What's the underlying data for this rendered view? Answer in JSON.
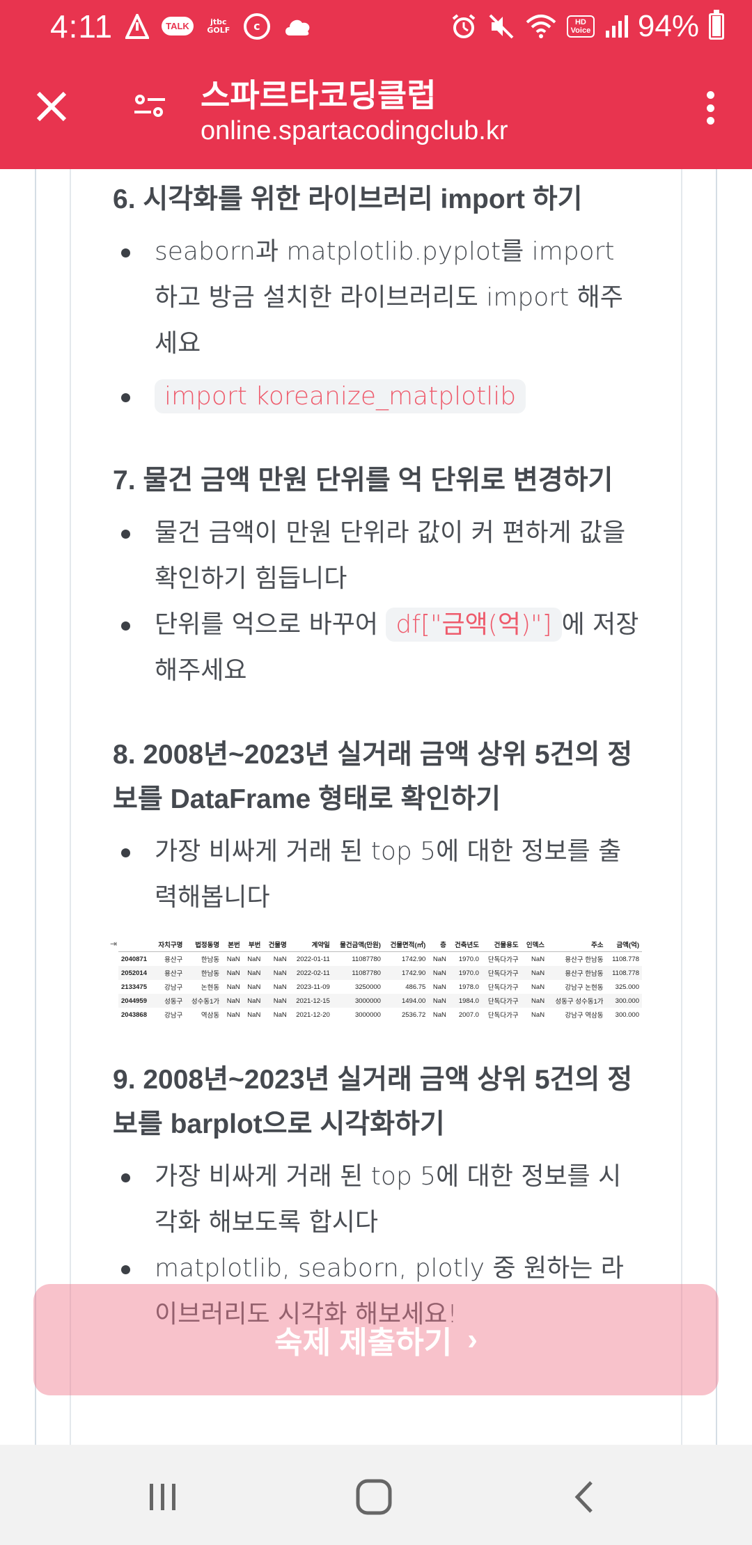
{
  "status_bar": {
    "time": "4:11",
    "battery": "94%",
    "battery_level": 0.94,
    "left_icons": [
      "signal-alert-icon",
      "kakaotalk-icon",
      "jtbc-golf-icon",
      "coinbase-icon",
      "cloud-icon"
    ],
    "right_icons": [
      "alarm-icon",
      "mute-icon",
      "wifi-icon",
      "hd-voice-icon",
      "signal-icon",
      "battery-icon"
    ],
    "talk_label": "TALK",
    "jtbc_label": "jtbc GOLF",
    "hd_label": "HD Voice"
  },
  "app_bar": {
    "title": "스파르타코딩클럽",
    "url": "online.spartacodingclub.kr",
    "close_icon": "close-icon",
    "settings_icon": "settings-icon",
    "more_icon": "more-vertical-icon",
    "accent_color": "#e8344f"
  },
  "sections": {
    "s6": {
      "heading": "6. 시각화를 위한 라이브러리 import 하기",
      "item1": "seaborn과 matplotlib.pyplot를 import 하고 방금 설치한 라이브러리도 import 해주세요",
      "item2_code": "import koreanize_matplotlib"
    },
    "s7": {
      "heading": "7. 물건 금액 만원 단위를 억 단위로 변경하기",
      "item1": "물건 금액이 만원 단위라 값이 커 편하게 값을 확인하기 힘듭니다",
      "item2_before": "단위를 억으로 바꾸어 ",
      "item2_code": "df[\"금액(억)\"]",
      "item2_after": "에 저장해주세요"
    },
    "s8": {
      "heading": "8. 2008년~2023년 실거래 금액 상위 5건의 정보를 DataFrame 형태로 확인하기",
      "item1": "가장 비싸게 거래 된 top 5에 대한 정보를 출력해봅니다"
    },
    "s9": {
      "heading": "9. 2008년~2023년 실거래 금액 상위 5건의 정보를 barplot으로 시각화하기",
      "item1": "가장 비싸게 거래 된 top 5에 대한 정보를 시각화 해보도록 합시다",
      "item2": "matplotlib, seaborn, plotly 중 원하는 라이브러리도 시각화 해보세요!"
    }
  },
  "dataframe": {
    "columns": [
      "",
      "자치구명",
      "법정동명",
      "본번",
      "부번",
      "건물명",
      "계약일",
      "물건금액(만원)",
      "건물면적(㎡)",
      "층",
      "건축년도",
      "건물용도",
      "인덱스",
      "주소",
      "금액(억)"
    ],
    "rows": [
      [
        "2040871",
        "용산구",
        "한남동",
        "NaN",
        "NaN",
        "NaN",
        "2022-01-11",
        "11087780",
        "1742.90",
        "NaN",
        "1970.0",
        "단독다가구",
        "NaN",
        "용산구 한남동",
        "1108.778"
      ],
      [
        "2052014",
        "용산구",
        "한남동",
        "NaN",
        "NaN",
        "NaN",
        "2022-02-11",
        "11087780",
        "1742.90",
        "NaN",
        "1970.0",
        "단독다가구",
        "NaN",
        "용산구 한남동",
        "1108.778"
      ],
      [
        "2133475",
        "강남구",
        "논현동",
        "NaN",
        "NaN",
        "NaN",
        "2023-11-09",
        "3250000",
        "486.75",
        "NaN",
        "1978.0",
        "단독다가구",
        "NaN",
        "강남구 논현동",
        "325.000"
      ],
      [
        "2044959",
        "성동구",
        "성수동1가",
        "NaN",
        "NaN",
        "NaN",
        "2021-12-15",
        "3000000",
        "1494.00",
        "NaN",
        "1984.0",
        "단독다가구",
        "NaN",
        "성동구 성수동1가",
        "300.000"
      ],
      [
        "2043868",
        "강남구",
        "역삼동",
        "NaN",
        "NaN",
        "NaN",
        "2021-12-20",
        "3000000",
        "2536.72",
        "NaN",
        "2007.0",
        "단독다가구",
        "NaN",
        "강남구 역삼동",
        "300.000"
      ]
    ]
  },
  "submit_button": {
    "label": "숙제 제출하기",
    "chevron": "›"
  },
  "nav_bar": {
    "recents_icon": "recents-icon",
    "home_icon": "home-icon",
    "back_icon": "back-icon"
  }
}
